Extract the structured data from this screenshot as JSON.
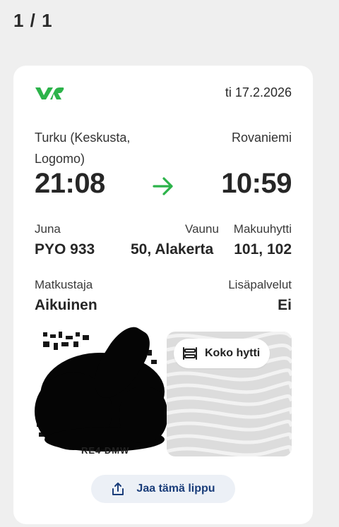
{
  "header": {
    "counter": "1 / 1"
  },
  "ticket": {
    "date": "ti 17.2.2026",
    "departure": {
      "station": "Turku (Keskusta, Logomo)",
      "time": "21:08"
    },
    "arrival": {
      "station": "Rovaniemi",
      "time": "10:59"
    },
    "train": {
      "label": "Juna",
      "value": "PYO 933"
    },
    "car": {
      "label": "Vaunu",
      "value": "50, Alakerta"
    },
    "cabin": {
      "label": "Makuuhytti",
      "value": "101, 102"
    },
    "passenger": {
      "label": "Matkustaja",
      "value": "Aikuinen"
    },
    "extras": {
      "label": "Lisäpalvelut",
      "value": "Ei"
    },
    "qr_code_partial_text": "RE4 DMW",
    "cabin_badge": "Koko hytti",
    "share_label": "Jaa tämä lippu"
  },
  "colors": {
    "brand_green": "#2cb34a",
    "share_text": "#1a3d7a",
    "share_bg": "#ecf0f6"
  },
  "icons": {
    "logo": "vr-logo",
    "arrow": "arrow-right-icon",
    "bed": "bunk-bed-icon",
    "share": "share-upload-icon"
  }
}
